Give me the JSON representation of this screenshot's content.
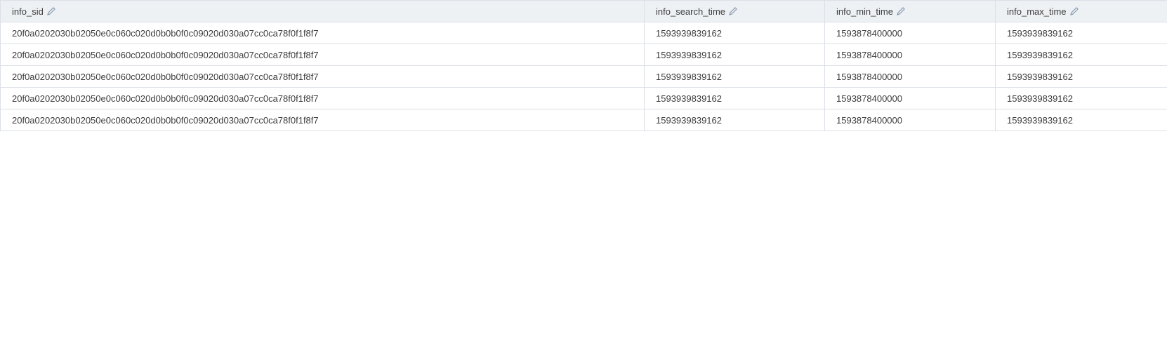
{
  "table": {
    "columns": [
      {
        "label": "info_sid",
        "icon": "edit-icon"
      },
      {
        "label": "info_search_time",
        "icon": "edit-icon"
      },
      {
        "label": "info_min_time",
        "icon": "edit-icon"
      },
      {
        "label": "info_max_time",
        "icon": "edit-icon"
      }
    ],
    "rows": [
      [
        "20f0a0202030b02050e0c060c020d0b0b0f0c09020d030a07cc0ca78f0f1f8f7",
        "1593939839162",
        "1593878400000",
        "1593939839162"
      ],
      [
        "20f0a0202030b02050e0c060c020d0b0b0f0c09020d030a07cc0ca78f0f1f8f7",
        "1593939839162",
        "1593878400000",
        "1593939839162"
      ],
      [
        "20f0a0202030b02050e0c060c020d0b0b0f0c09020d030a07cc0ca78f0f1f8f7",
        "1593939839162",
        "1593878400000",
        "1593939839162"
      ],
      [
        "20f0a0202030b02050e0c060c020d0b0b0f0c09020d030a07cc0ca78f0f1f8f7",
        "1593939839162",
        "1593878400000",
        "1593939839162"
      ],
      [
        "20f0a0202030b02050e0c060c020d0b0b0f0c09020d030a07cc0ca78f0f1f8f7",
        "1593939839162",
        "1593878400000",
        "1593939839162"
      ]
    ]
  }
}
